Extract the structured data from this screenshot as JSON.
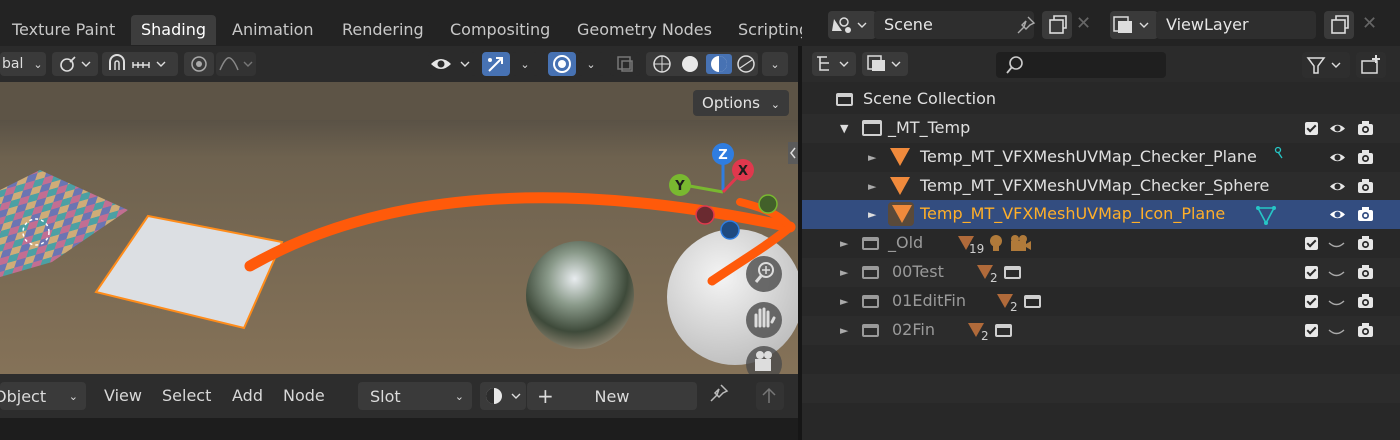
{
  "workspace_tabs": [
    {
      "label": "Texture Paint",
      "active": false
    },
    {
      "label": "Shading",
      "active": true
    },
    {
      "label": "Animation",
      "active": false
    },
    {
      "label": "Rendering",
      "active": false
    },
    {
      "label": "Compositing",
      "active": false
    },
    {
      "label": "Geometry Nodes",
      "active": false
    },
    {
      "label": "Scripting",
      "active": false
    }
  ],
  "viewport_header": {
    "transform_orientation_partial": "bal"
  },
  "viewport": {
    "options_label": "Options",
    "gizmo": {
      "z": "Z",
      "y": "Y",
      "x": "X"
    },
    "colors": {
      "floor": "#7a6a55",
      "horizon": "#5c5346",
      "arrow": "#ff5a0a",
      "selected_outline": "#ff8c1a",
      "gizmo_z": "#2f7de0",
      "gizmo_y": "#79b830",
      "gizmo_x": "#e0384d"
    }
  },
  "bottom_header": {
    "mode": "Object",
    "menus": [
      "View",
      "Select",
      "Add",
      "Node"
    ],
    "slot": "Slot",
    "new_button": "New"
  },
  "scene_selector": {
    "value": "Scene"
  },
  "view_layer": {
    "value": "ViewLayer"
  },
  "outliner": {
    "search_placeholder": "",
    "rows": [
      {
        "label": "Scene Collection",
        "type": "scene-collection"
      },
      {
        "label": "_MT_Temp",
        "type": "collection",
        "expanded": true
      },
      {
        "label": "Temp_MT_VFXMeshUVMap_Checker_Plane",
        "type": "mesh"
      },
      {
        "label": "Temp_MT_VFXMeshUVMap_Checker_Sphere",
        "type": "mesh"
      },
      {
        "label": "Temp_MT_VFXMeshUVMap_Icon_Plane",
        "type": "mesh",
        "selected": true
      },
      {
        "label": "_Old",
        "type": "collection",
        "child_count": "19"
      },
      {
        "label": "00Test",
        "type": "collection",
        "child_count": "2"
      },
      {
        "label": "01EditFin",
        "type": "collection",
        "child_count": "2"
      },
      {
        "label": "02Fin",
        "type": "collection",
        "child_count": "2"
      }
    ],
    "colors": {
      "selected_row": "#334d80",
      "selected_text": "#ffaf29",
      "mesh_icon": "#f08a3c",
      "data_icon": "#26c6c6"
    }
  }
}
